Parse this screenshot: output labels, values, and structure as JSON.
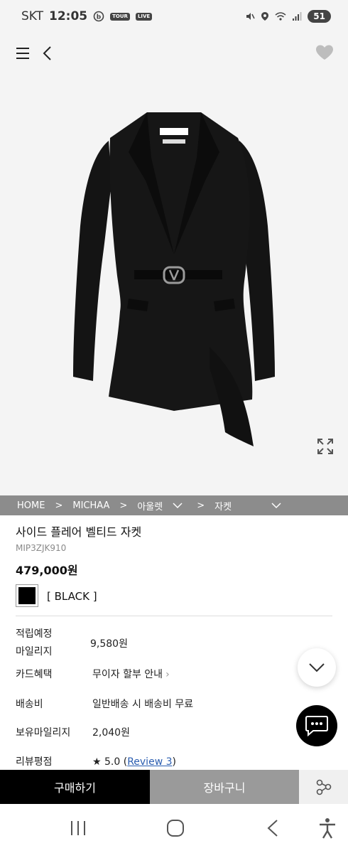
{
  "status_bar": {
    "carrier": "SKT",
    "time": "12:05",
    "badge_tour": "TOUR",
    "badge_live": "LIVE",
    "battery": "51"
  },
  "breadcrumb": {
    "items": [
      "HOME",
      "MICHAA",
      "아울렛",
      "자켓"
    ],
    "separator": ">"
  },
  "product": {
    "name": "사이드 플레어 벨티드 자켓",
    "code": "MIP3ZJK910",
    "price": "479,000원",
    "color_label": "[ BLACK ]",
    "swatch_color": "#000000"
  },
  "info": {
    "mileage_label_line1": "적립예정",
    "mileage_label_line2": "마일리지",
    "mileage_value": "9,580원",
    "card_label": "카드혜택",
    "card_value": "무이자 할부 안내",
    "shipping_label": "배송비",
    "shipping_value": "일반배송 시 배송비 무료",
    "owned_mileage_label": "보유마일리지",
    "owned_mileage_value": "2,040원",
    "review_label": "리뷰평점",
    "review_score": "★ 5.0",
    "review_link": "Review 3"
  },
  "actions": {
    "buy_label": "구매하기",
    "cart_label": "장바구니"
  },
  "icons": {
    "menu": "hamburger-menu-icon",
    "back": "chevron-left-icon",
    "wishlist": "heart-icon",
    "expand": "expand-icon",
    "scroll_down": "chevron-down-icon",
    "chat": "chat-bubble-icon",
    "share": "share-icon"
  },
  "colors": {
    "breadcrumb_bg": "#8c8c8c",
    "buy_bg": "#000000",
    "cart_bg": "#9a9a9a",
    "link": "#2a5db0"
  }
}
